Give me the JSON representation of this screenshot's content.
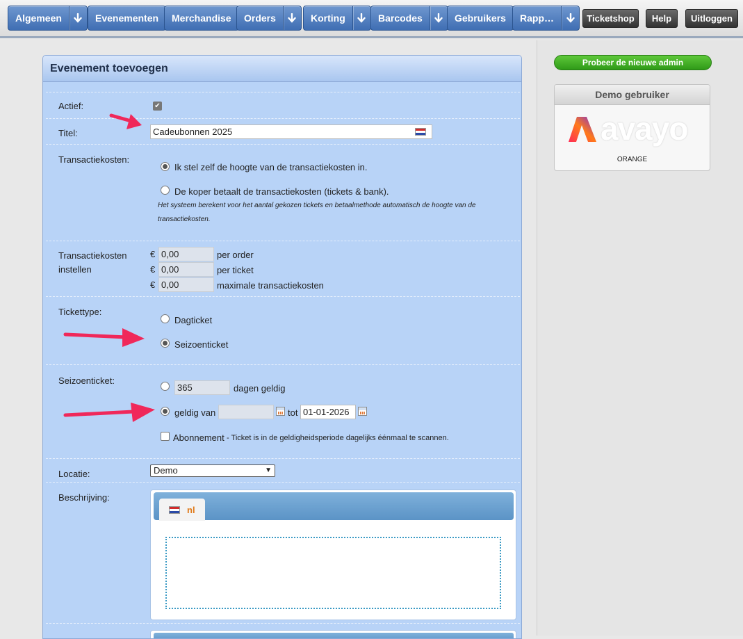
{
  "nav": {
    "items": [
      {
        "label": "Algemeen",
        "dropdown": true
      },
      {
        "label": "Evenementen",
        "dropdown": false
      },
      {
        "label": "Merchandise",
        "dropdown": false
      },
      {
        "label": "Orders",
        "dropdown": true
      },
      {
        "label": "Korting",
        "dropdown": true
      },
      {
        "label": "Barcodes",
        "dropdown": true
      },
      {
        "label": "Gebruikers",
        "dropdown": false
      },
      {
        "label": "Rapp…",
        "dropdown": true
      }
    ],
    "ticketshop": "Ticketshop",
    "help": "Help",
    "logout": "Uitloggen"
  },
  "sidebar": {
    "new_admin": "Probeer de nieuwe admin",
    "demo_title": "Demo gebruiker",
    "logo_text": "avayo",
    "demo_sub": "ORANGE"
  },
  "form": {
    "title": "Evenement toevoegen",
    "actief_label": "Actief:",
    "actief_checked": true,
    "titel_label": "Titel:",
    "titel_value": "Cadeubonnen 2025",
    "transactiekosten_label": "Transactiekosten:",
    "tk_option1": "Ik stel zelf de hoogte van de transactiekosten in.",
    "tk_option2": "De koper betaalt de transactiekosten (tickets & bank).",
    "tk_note_line1": "Het systeem berekent voor het aantal gekozen tickets en betaalmethode automatisch de hoogte van de",
    "tk_note_line2": "transactiekosten.",
    "tk_instellen_line1": "Transactiekosten",
    "tk_instellen_line2": "instellen",
    "currency": "€",
    "cost_per_order": "0,00",
    "cost_per_order_label": "per order",
    "cost_per_ticket": "0,00",
    "cost_per_ticket_label": "per ticket",
    "cost_max": "0,00",
    "cost_max_label": "maximale transactiekosten",
    "tickettype_label": "Tickettype:",
    "tt_option1": "Dagticket",
    "tt_option2": "Seizoenticket",
    "seizoen_label": "Seizoenticket:",
    "days_value": "365",
    "days_label": "dagen geldig",
    "geldig_van_label": "geldig van",
    "date_from": "",
    "tot_label": "tot",
    "date_to": "01-01-2026",
    "abonnement_label": "Abonnement",
    "abonnement_note": " - Ticket is in de geldigheidsperiode dagelijks éénmaal te scannen.",
    "locatie_label": "Locatie:",
    "locatie_value": "Demo",
    "beschrijving_label": "Beschrijving:",
    "lang_tab": "nl"
  },
  "colors": {
    "nav_button": "#4a79bd",
    "panel_bg": "#b8d3f7",
    "arrow": "#f0285a",
    "new_admin": "#3aa820"
  }
}
